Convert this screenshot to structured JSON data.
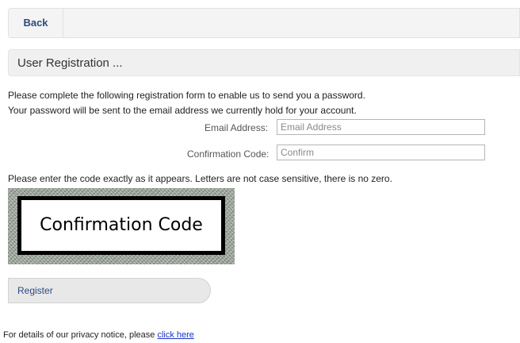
{
  "toolbar": {
    "back_label": "Back"
  },
  "section": {
    "title": "User Registration ..."
  },
  "intro": {
    "line1": "Please complete the following registration form to enable us to send you a password.",
    "line2": "Your password will be sent to the email address we currently hold for your account."
  },
  "form": {
    "email_label": "Email Address:",
    "email_placeholder": "Email Address",
    "email_value": "",
    "confirm_label": "Confirmation Code:",
    "confirm_placeholder": "Confirm",
    "confirm_value": ""
  },
  "captcha": {
    "instruction": "Please enter the code exactly as it appears. Letters are not case sensitive, there is no zero.",
    "text": "Confirmation Code"
  },
  "register": {
    "label": "Register"
  },
  "privacy": {
    "text": "For details of our privacy notice, please",
    "link_text": "click here"
  },
  "colors": {
    "link": "#1a35c6",
    "button_text": "#2b4a80",
    "toolbar_bg": "#f4f4f4"
  }
}
